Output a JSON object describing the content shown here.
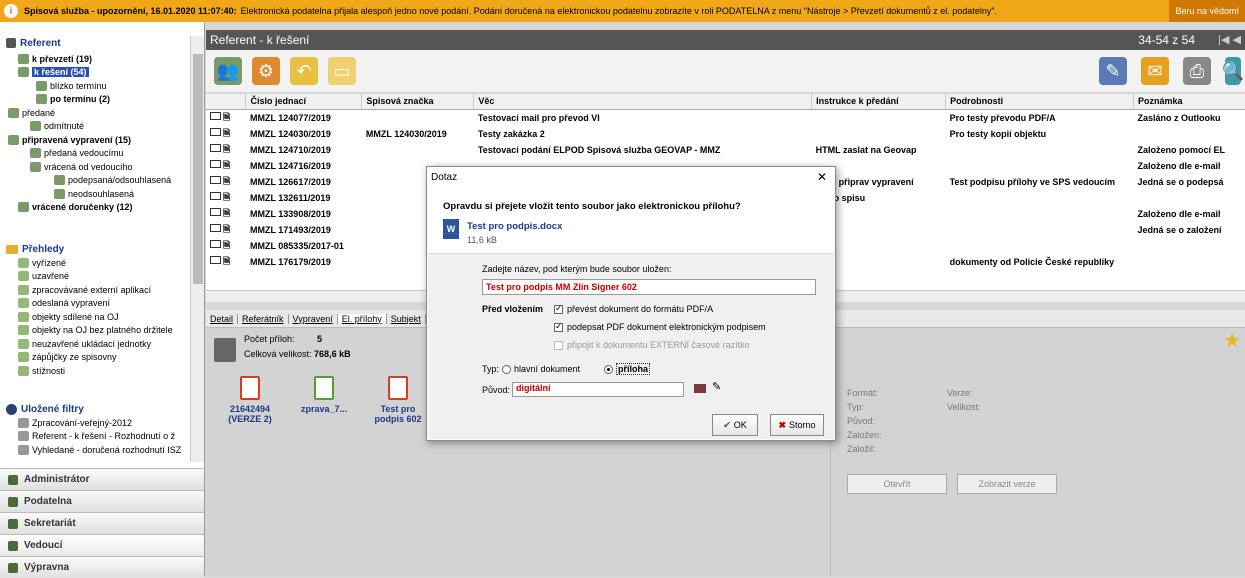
{
  "banner": {
    "title": "Spisová služba - upozornění, 16.01.2020 11:07:40:",
    "message": "Elektronická podatelna přijala alespoň jedno nové podání. Podání doručená na elektronickou podatelnu zobrazíte v roli PODATELNA z menu \"Nástroje > Převzetí dokumentů z el. podatelny\".",
    "right": "Beru na vědomí"
  },
  "sidebar": {
    "referent": "Referent",
    "referent_items": [
      {
        "label": "k převzetí (19)",
        "bold": true,
        "sel": false
      },
      {
        "label": "k řešení (54)",
        "bold": true,
        "sel": true
      },
      {
        "label": "blízko termínu",
        "bold": false,
        "sel": false
      },
      {
        "label": "po termínu (2)",
        "bold": true,
        "sel": false
      },
      {
        "label": "předané",
        "bold": false,
        "sel": false
      },
      {
        "label": "odmítnuté",
        "bold": false,
        "sel": false
      },
      {
        "label": "připravená vypravení (15)",
        "bold": true,
        "sel": false
      },
      {
        "label": "předaná vedoucímu",
        "bold": false,
        "sel": false
      },
      {
        "label": "vrácená od vedoucího",
        "bold": false,
        "sel": false
      },
      {
        "label": "podepsaná/odsouhlasená",
        "bold": false,
        "sel": false
      },
      {
        "label": "neodsouhlasená",
        "bold": false,
        "sel": false
      },
      {
        "label": "vrácené doručenky (12)",
        "bold": true,
        "sel": false
      }
    ],
    "prehledy": "Přehledy",
    "prehledy_items": [
      "vyřízené",
      "uzavřené",
      "zpracovávané externí aplikací",
      "odeslaná vypravení",
      "objekty sdílené na OJ",
      "objekty na OJ bez platného držitele",
      "neuzavřené ukládací jednotky",
      "zápůjčky ze spisovny",
      "stížnosti"
    ],
    "filtry": "Uložené filtry",
    "filtry_items": [
      "Zpracování-veřejný-2012",
      "Referent - k řešení - Rozhodnutí o ž",
      "Vyhledané - doručená rozhodnutí ISZ"
    ],
    "bottom": [
      "Administrátor",
      "Podatelna",
      "Sekretariát",
      "Vedoucí",
      "Výpravna"
    ]
  },
  "main": {
    "title": "Referent - k řešení",
    "pager": "34-54 z 54",
    "columns": [
      "Číslo jednací",
      "Spisová značka",
      "Věc",
      "Instrukce k předání",
      "Podrobnosti",
      "Poznámka"
    ],
    "rows": [
      [
        "MMZL 124077/2019",
        "",
        "Testovací mail pro převod VI",
        "",
        "Pro testy převodu PDF/A",
        "Zasláno z Outlooku"
      ],
      [
        "MMZL 124030/2019",
        "MMZL 124030/2019",
        "Testy zakázka 2",
        "",
        "Pro testy kopií objektu",
        ""
      ],
      [
        "MMZL 124710/2019",
        "",
        "Testovací podání ELPOD Spisová služba GEOVAP - MMZ",
        "HTML zaslat na Geovap",
        "",
        "Založeno pomocí EL"
      ],
      [
        "MMZL 124716/2019",
        "",
        "",
        "",
        "",
        "Založeno dle e-mail"
      ],
      [
        "MMZL 126617/2019",
        "",
        "",
        "aluji, připrav vypravení",
        "Test podpisu přílohy ve SPS vedoucím",
        "Jedná se o podepsá"
      ],
      [
        "MMZL 132611/2019",
        "",
        "",
        "žit do spisu",
        "",
        ""
      ],
      [
        "MMZL 133908/2019",
        "",
        "",
        "",
        "",
        "Založeno dle e-mail"
      ],
      [
        "MMZL 171493/2019",
        "",
        "",
        "",
        "",
        "Jedná se o založení"
      ],
      [
        "MMZL 085335/2017-01",
        "",
        "",
        "",
        "",
        ""
      ],
      [
        "MMZL 176179/2019",
        "",
        "",
        "",
        "dokumenty od Policie České republiky",
        ""
      ]
    ],
    "tabs": [
      "Detail",
      "Referátník",
      "Vypravení",
      "El. přílohy",
      "Subjekt"
    ],
    "pocet_label": "Počet příloh:",
    "pocet_value": "5",
    "velikost_label": "Celková velikost:",
    "velikost_value": "768,6 kB",
    "docs": [
      "21642494 (VERZE 2)",
      "zprava_7...",
      "Test pro podpis 602",
      "Te po"
    ],
    "right_labels_a": [
      "Formát:",
      "Typ:",
      "Původ:",
      "Založen:",
      "Založil:"
    ],
    "right_labels_b": [
      "Verze:",
      "Velikost:"
    ],
    "btn_open": "Otevřít",
    "btn_version": "Zobrazit verze"
  },
  "dialog": {
    "title": "Dotaz",
    "question": "Opravdu si přejete vložit tento soubor jako elektronickou přílohu?",
    "filename": "Test pro podpis.docx",
    "filesize": "11,6 kB",
    "name_label": "Zadejte název, pod kterým bude soubor uložen:",
    "name_value": "Test pro podpis MM Zlín Signer 602",
    "before_label": "Před vložením",
    "opt1": "převést dokument do formátu PDF/A",
    "opt2": "podepsat PDF dokument elektronickým podpisem",
    "opt3": "připojit k dokumentu EXTERNÍ časové razítko",
    "typ_label": "Typ:",
    "typ_opt1": "hlavní dokument",
    "typ_opt2": "příloha",
    "puvod_label": "Původ:",
    "puvod_value": "digitální",
    "ok": "OK",
    "storno": "Storno"
  }
}
